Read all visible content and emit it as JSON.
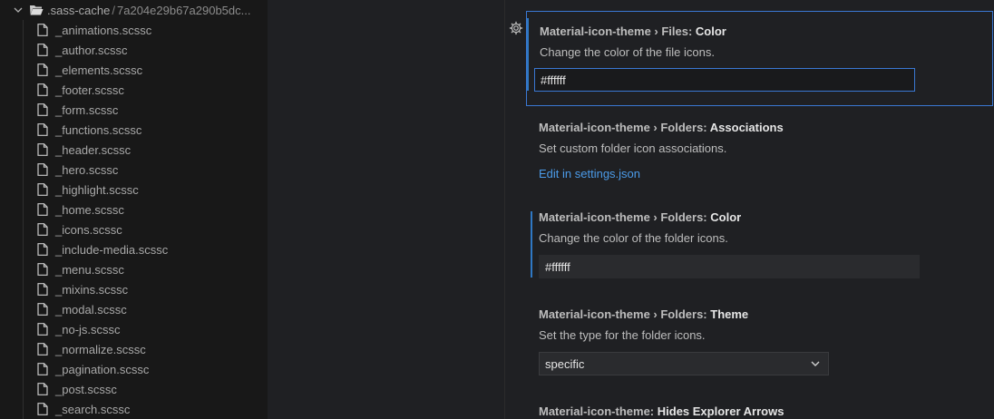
{
  "explorer": {
    "folder": {
      "label": ".sass-cache",
      "sublabel": "7a204e29b67a290b5dc...",
      "separator": "/",
      "icons": {
        "chevron": "chevron-down-icon",
        "folder": "folder-open-icon"
      }
    },
    "file_icon": "file-icon",
    "files": [
      "_animations.scssc",
      "_author.scssc",
      "_elements.scssc",
      "_footer.scssc",
      "_form.scssc",
      "_functions.scssc",
      "_header.scssc",
      "_hero.scssc",
      "_highlight.scssc",
      "_home.scssc",
      "_icons.scssc",
      "_include-media.scssc",
      "_menu.scssc",
      "_mixins.scssc",
      "_modal.scssc",
      "_no-js.scssc",
      "_normalize.scssc",
      "_pagination.scssc",
      "_post.scssc",
      "_search.scssc"
    ]
  },
  "settings": {
    "gear_icon": "gear-icon",
    "files_color": {
      "category": "Material-icon-theme › Files: ",
      "key": "Color",
      "description": "Change the color of the file icons.",
      "value": "#ffffff"
    },
    "folders_associations": {
      "category": "Material-icon-theme › Folders: ",
      "key": "Associations",
      "description": "Set custom folder icon associations.",
      "link": "Edit in settings.json"
    },
    "folders_color": {
      "category": "Material-icon-theme › Folders: ",
      "key": "Color",
      "description": "Change the color of the folder icons.",
      "value": "#ffffff"
    },
    "folders_theme": {
      "category": "Material-icon-theme › Folders: ",
      "key": "Theme",
      "description": "Set the type for the folder icons.",
      "selected": "specific"
    },
    "hides_explorer_arrows": {
      "category": "Material-icon-theme: ",
      "key": "Hides Explorer Arrows"
    }
  },
  "colors": {
    "accent": "#3a78d3",
    "link": "#4b9be9",
    "modified_bar": "#2f78c4",
    "sidebar_bg": "#181818",
    "editor_bg": "#1f2023"
  }
}
